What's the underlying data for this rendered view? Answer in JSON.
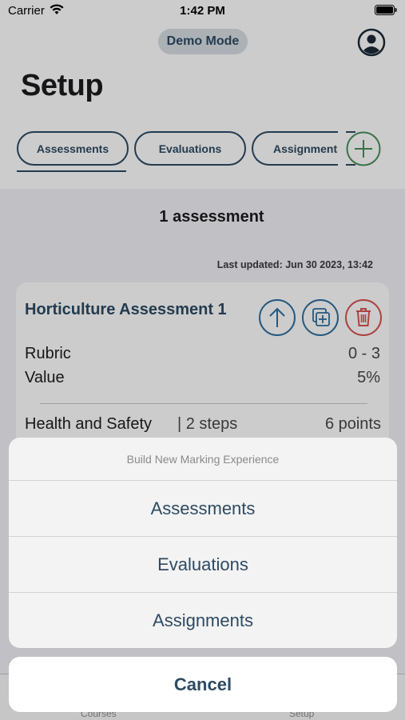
{
  "status_bar": {
    "carrier": "Carrier",
    "time": "1:42 PM",
    "wifi_icon": "wifi-icon",
    "battery_icon": "battery-icon"
  },
  "header": {
    "demo_mode_label": "Demo Mode",
    "profile_icon": "person-circle-icon",
    "title": "Setup"
  },
  "tabs": [
    {
      "label": "Assessments",
      "selected": true
    },
    {
      "label": "Evaluations",
      "selected": false
    },
    {
      "label": "Assignments",
      "selected": false
    }
  ],
  "add_tab_icon": "plus-circle-icon",
  "content": {
    "count_title": "1 assessment",
    "last_updated": "Last updated: Jun 30 2023, 13:42"
  },
  "card": {
    "title": "Horticulture Assessment 1",
    "actions": [
      {
        "icon": "arrow-up-circle-icon"
      },
      {
        "icon": "duplicate-icon"
      },
      {
        "icon": "trash-icon"
      }
    ],
    "rows": [
      {
        "label": "Rubric",
        "value": "0 - 3"
      },
      {
        "label": "Value",
        "value": "5%"
      }
    ],
    "step": {
      "label": "Health and Safety",
      "count": "| 2 steps",
      "points": "6 points"
    }
  },
  "tab_bar": {
    "items": [
      {
        "label": "Courses"
      },
      {
        "label": "Setup"
      }
    ]
  },
  "action_sheet": {
    "title": "Build New Marking Experience",
    "options": [
      {
        "label": "Assessments"
      },
      {
        "label": "Evaluations"
      },
      {
        "label": "Assignments"
      }
    ],
    "cancel_label": "Cancel"
  },
  "colors": {
    "accent": "#2e4a63",
    "add_green": "#4a8f5a",
    "delete_red": "#d9534f",
    "action_blue": "#2f6f9e"
  }
}
